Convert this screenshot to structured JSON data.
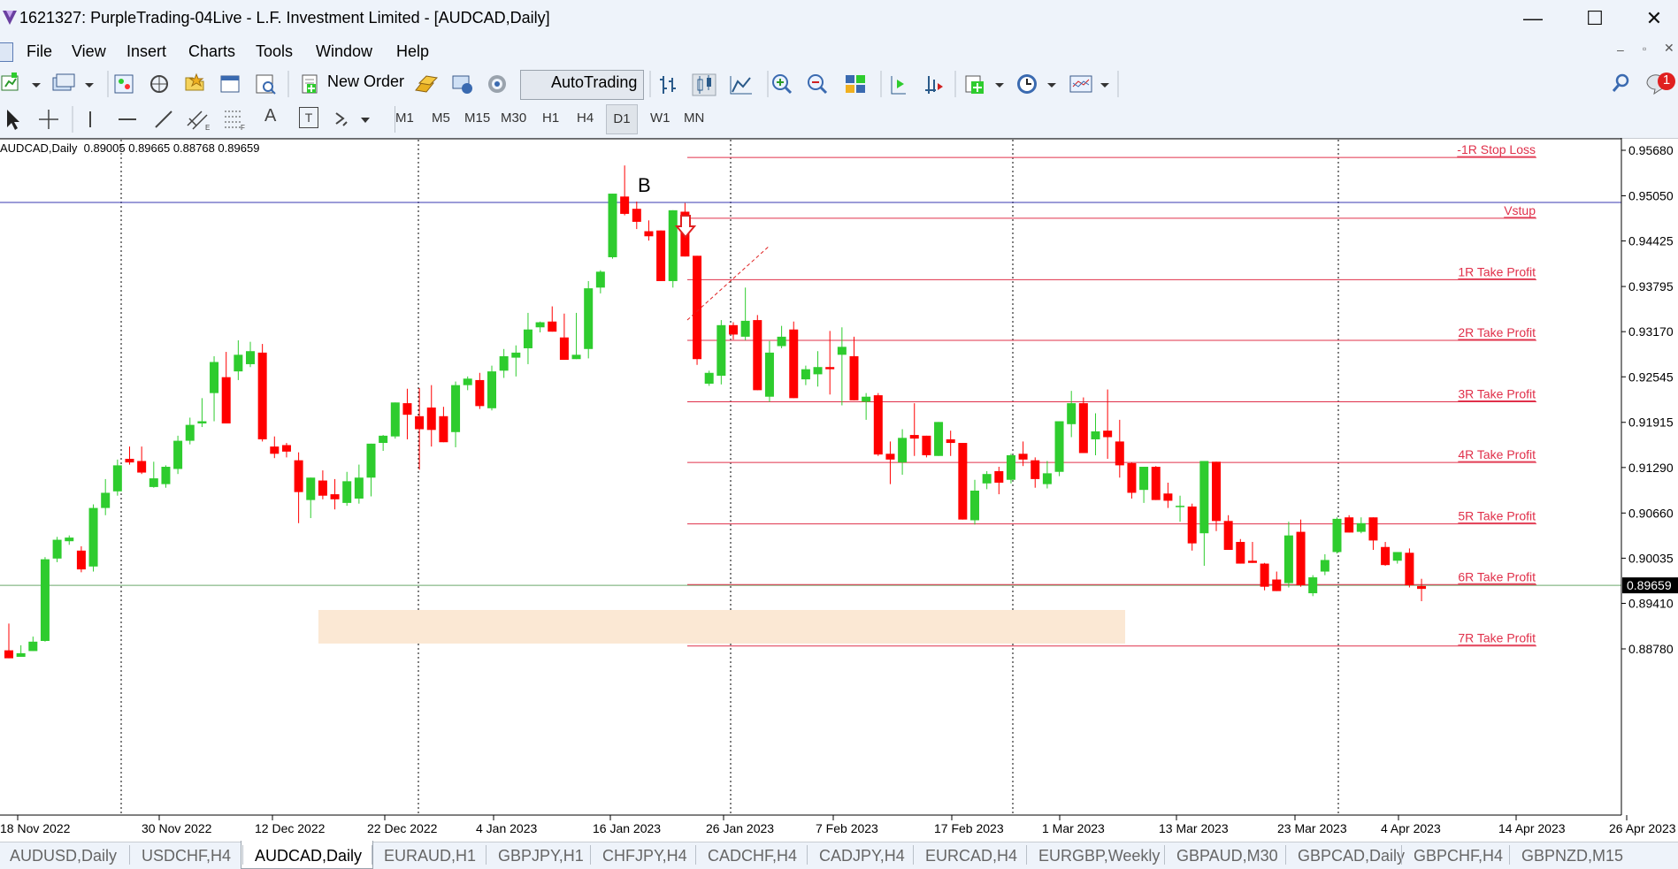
{
  "window": {
    "title": "1621327: PurpleTrading-04Live - L.F. Investment Limited - [AUDCAD,Daily]",
    "minimize": "—",
    "maximize": "☐",
    "close": "✕"
  },
  "menu": [
    "File",
    "View",
    "Insert",
    "Charts",
    "Tools",
    "Window",
    "Help"
  ],
  "toolbar": {
    "new_order": "New Order",
    "autotrading": "AutoTrading",
    "timeframes": [
      "M1",
      "M5",
      "M15",
      "M30",
      "H1",
      "H4",
      "D1",
      "W1",
      "MN"
    ],
    "active_timeframe": "D1",
    "notification_count": "1",
    "text_tool": "A",
    "textlabel_tool": "T"
  },
  "chart": {
    "info_line": "AUDCAD,Daily  0.89005 0.89665 0.88768 0.89659",
    "marker_label": "B",
    "current_price": "0.89659",
    "price_ticks": [
      "0.95680",
      "0.95050",
      "0.94425",
      "0.93795",
      "0.93170",
      "0.92545",
      "0.91915",
      "0.91290",
      "0.90660",
      "0.90035",
      "0.89410",
      "0.88780"
    ],
    "date_ticks": [
      "18 Nov 2022",
      "30 Nov 2022",
      "12 Dec 2022",
      "22 Dec 2022",
      "4 Jan 2023",
      "16 Jan 2023",
      "26 Jan 2023",
      "7 Feb 2023",
      "17 Feb 2023",
      "1 Mar 2023",
      "13 Mar 2023",
      "23 Mar 2023",
      "4 Apr 2023",
      "14 Apr 2023",
      "26 Apr 2023"
    ],
    "levels": [
      {
        "label": "-1R Stop Loss",
        "price": 0.9558
      },
      {
        "label": "Vstup",
        "price": 0.9474
      },
      {
        "label": "1R Take Profit",
        "price": 0.9389
      },
      {
        "label": "2R Take Profit",
        "price": 0.9305
      },
      {
        "label": "3R Take Profit",
        "price": 0.922
      },
      {
        "label": "4R Take Profit",
        "price": 0.9136
      },
      {
        "label": "5R Take Profit",
        "price": 0.9051
      },
      {
        "label": "6R Take Profit",
        "price": 0.8967
      },
      {
        "label": "7R Take Profit",
        "price": 0.8882
      }
    ],
    "colors": {
      "bull": "#2ecc2e",
      "bear": "#ff0000",
      "level": "#e0304a",
      "horizontal": "#3a3ab0",
      "zone": "#fbe8d4",
      "price_line": "#6aa86a"
    }
  },
  "tabs": [
    "AUDUSD,Daily",
    "USDCHF,H4",
    "AUDCAD,Daily",
    "EURAUD,H1",
    "GBPJPY,H1",
    "CHFJPY,H4",
    "CADCHF,H4",
    "CADJPY,H4",
    "EURCAD,H4",
    "EURGBP,Weekly",
    "GBPAUD,M30",
    "GBPCAD,Daily",
    "GBPCHF,H4",
    "GBPNZD,M15"
  ],
  "active_tab": "AUDCAD,Daily"
}
